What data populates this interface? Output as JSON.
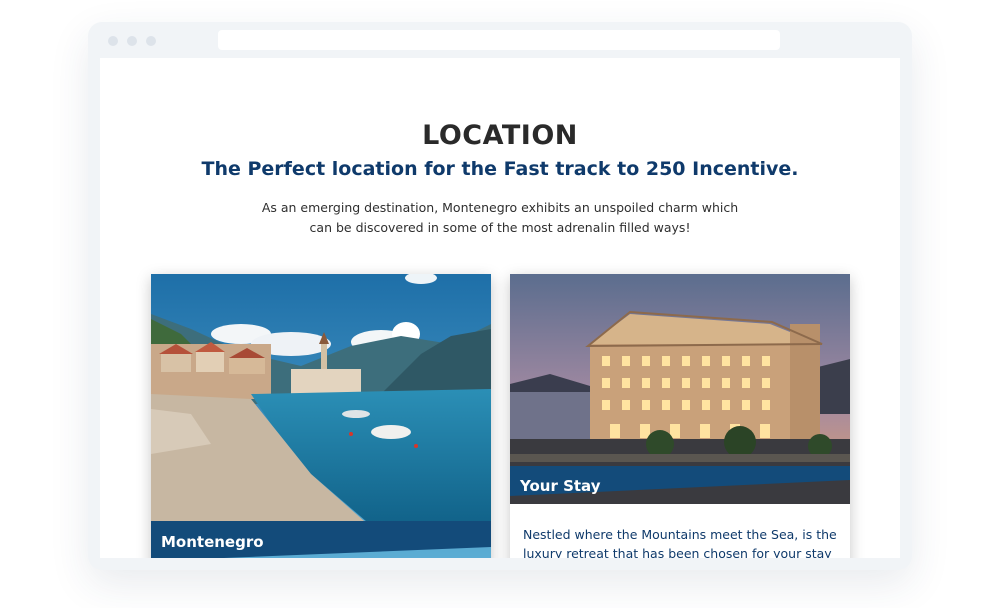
{
  "section": {
    "heading": "LOCATION",
    "subheading": "The Perfect location for the Fast track to 250 Incentive.",
    "intro": "As an emerging destination, Montenegro exhibits an unspoiled charm which can be discovered in some of the most adrenalin filled ways!"
  },
  "cards": [
    {
      "title": "Montenegro",
      "image_icon": "bay-town-photo"
    },
    {
      "title": "Your Stay",
      "image_icon": "hotel-photo",
      "body": "Nestled where the Mountains meet the Sea, is the luxury retreat that has been chosen for your stay whilst in"
    }
  ],
  "colors": {
    "accent_navy": "#0f3a6b",
    "band_blue": "#134b7a",
    "frame": "#f1f4f7"
  }
}
